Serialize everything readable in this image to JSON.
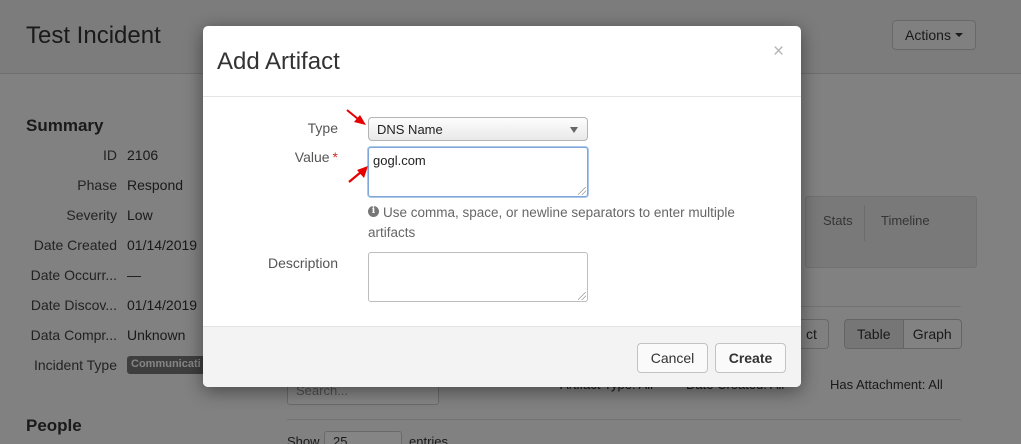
{
  "page": {
    "title": "Test Incident",
    "actions_label": "Actions"
  },
  "summary": {
    "heading": "Summary",
    "rows": [
      {
        "key": "ID",
        "value": "2106"
      },
      {
        "key": "Phase",
        "value": "Respond"
      },
      {
        "key": "Severity",
        "value": "Low"
      },
      {
        "key": "Date Created",
        "value": "01/14/2019"
      },
      {
        "key": "Date Occurr...",
        "value": "—"
      },
      {
        "key": "Date Discov...",
        "value": "01/14/2019"
      },
      {
        "key": "Data Compr...",
        "value": "Unknown"
      },
      {
        "key": "Incident Type",
        "value": "Communicati"
      }
    ]
  },
  "people": {
    "heading": "People"
  },
  "tabs": {
    "stats": "Stats",
    "timeline": "Timeline"
  },
  "artifacts_toolbar": {
    "fragment_button": "ct",
    "view_table": "Table",
    "view_graph": "Graph",
    "search_placeholder": "Search...",
    "filter_type": "Artifact Type: All",
    "filter_date": "Date Created: All",
    "filter_attachment": "Has Attachment: All",
    "show_label": "Show",
    "show_value": "25",
    "entries_label": "entries"
  },
  "modal": {
    "title": "Add Artifact",
    "close_glyph": "×",
    "type_label": "Type",
    "type_value": "DNS Name",
    "value_label": "Value",
    "required_mark": "*",
    "value_text": "gogl.com",
    "help_icon_glyph": "i",
    "help_text": "Use comma, space, or newline separators to enter multiple artifacts",
    "description_label": "Description",
    "cancel_label": "Cancel",
    "create_label": "Create"
  },
  "colors": {
    "overlay": "#000000",
    "annotation_arrow": "#e60000",
    "required": "#c9302c",
    "focus_border": "#7fa6d6"
  },
  "icons": [
    "caret-down-icon",
    "close-icon",
    "info-circle-icon",
    "select-arrow-icon",
    "search-icon"
  ]
}
